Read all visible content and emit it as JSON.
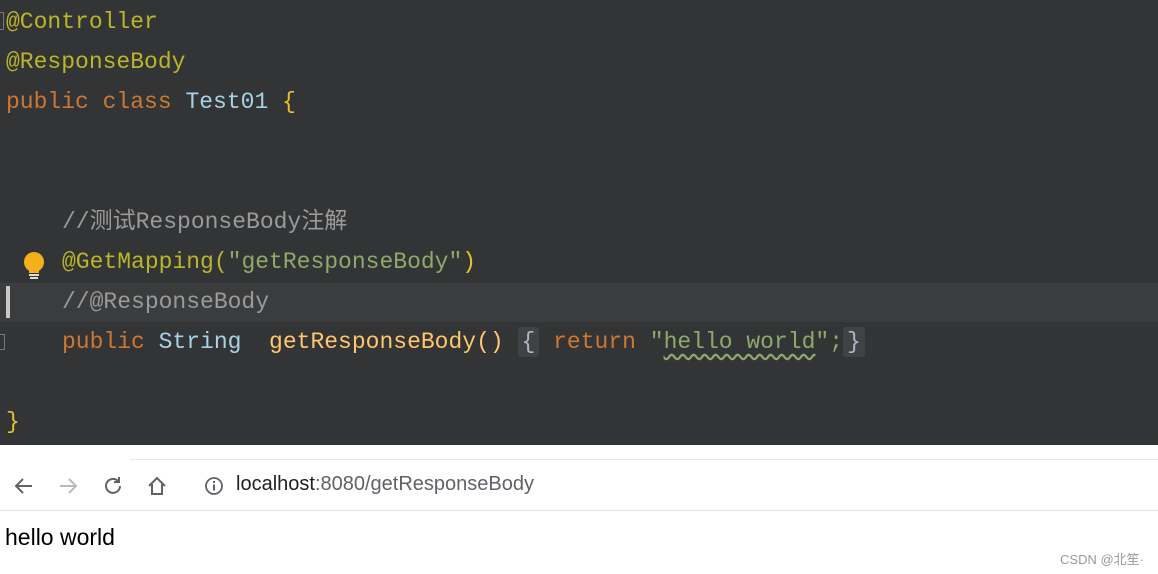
{
  "editor": {
    "lines": {
      "l1": "@Controller",
      "l2": "@ResponseBody",
      "l3_kw": "public class ",
      "l3_cls": "Test01 ",
      "l3_br": "{",
      "l6": "//测试ResponseBody注解",
      "l7_ann": "@GetMapping(",
      "l7_str": "\"getResponseBody\"",
      "l7_close": ")",
      "l8": "//@ResponseBody",
      "l9_kw": "public ",
      "l9_type": "String  ",
      "l9_fn": "getResponseBody()",
      "l9_open": "{",
      "l9_ret": "return ",
      "l9_q1": "\"",
      "l9_str": "hello world",
      "l9_q2": "\";",
      "l9_close": "}",
      "l11": "}"
    },
    "icons": {
      "intention": "lightbulb-icon"
    }
  },
  "browser": {
    "url_host": "localhost",
    "url_rest": ":8080/getResponseBody",
    "icons": [
      "back-icon",
      "forward-icon",
      "reload-icon",
      "home-icon",
      "info-icon"
    ],
    "content": "hello world",
    "watermark": "CSDN @北笙·"
  }
}
